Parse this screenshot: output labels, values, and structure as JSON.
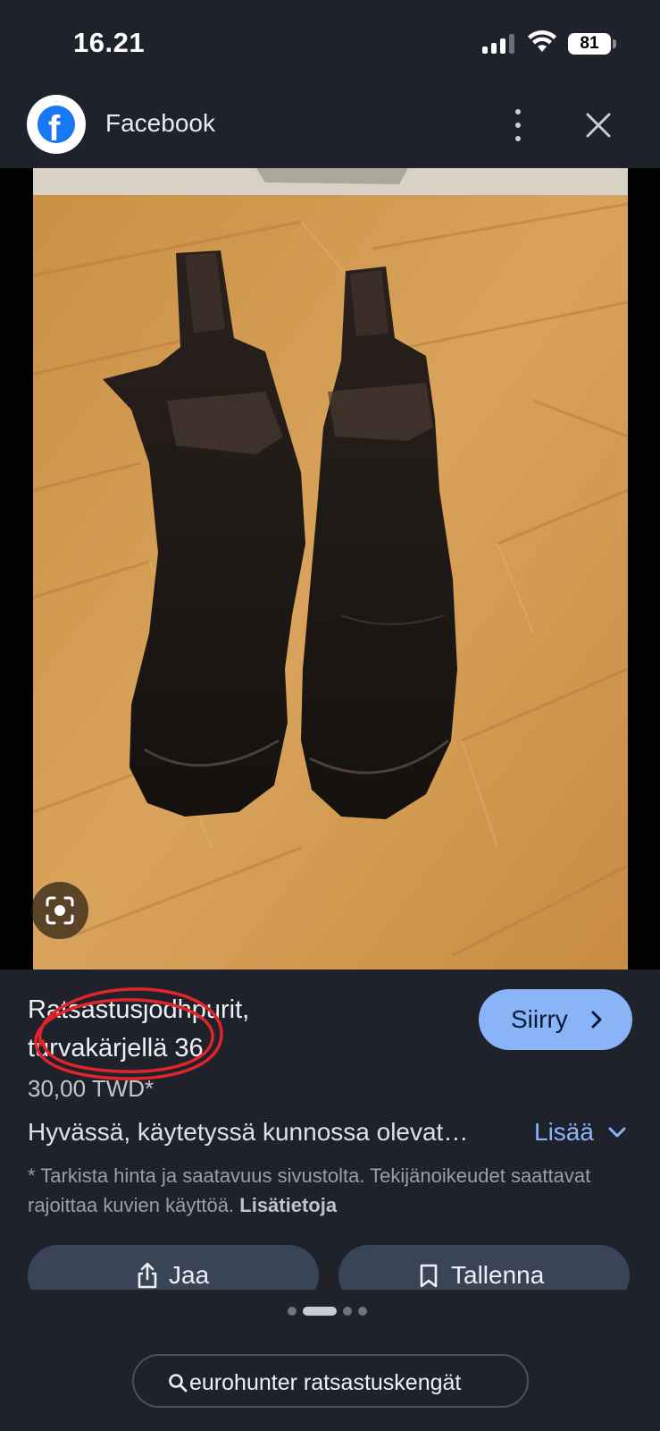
{
  "status_bar": {
    "time": "16.21",
    "battery": "81"
  },
  "header": {
    "app_name": "Facebook",
    "logo_letter": "f",
    "more_icon": "more-vertical-icon",
    "close_icon": "close-icon"
  },
  "image": {
    "lens_icon": "lens-search-icon"
  },
  "product": {
    "title": "Ratsastusjodhpurit, turvakärjellä 36",
    "visit_label": "Siirry",
    "price": "30,00 TWD*",
    "description": "Hyvässä, käytetyssä kunnossa olevat…",
    "more_label": "Lisää",
    "disclaimer": "* Tarkista hinta ja saatavuus sivustolta. Tekijänoikeudet saattavat rajoittaa kuvien käyttöä.",
    "disclaimer_link": "Lisätietoja"
  },
  "actions": {
    "share_label": "Jaa",
    "save_label": "Tallenna"
  },
  "pager": {
    "dot_count": 4,
    "active_index": 1
  },
  "related_search": {
    "label": "eurohunter ratsastuskengät"
  },
  "colors": {
    "background": "#1f222b",
    "accent": "#8ab4f8",
    "button": "#394456",
    "facebook_blue": "#1877f2",
    "annotation_red": "#e0242a"
  }
}
